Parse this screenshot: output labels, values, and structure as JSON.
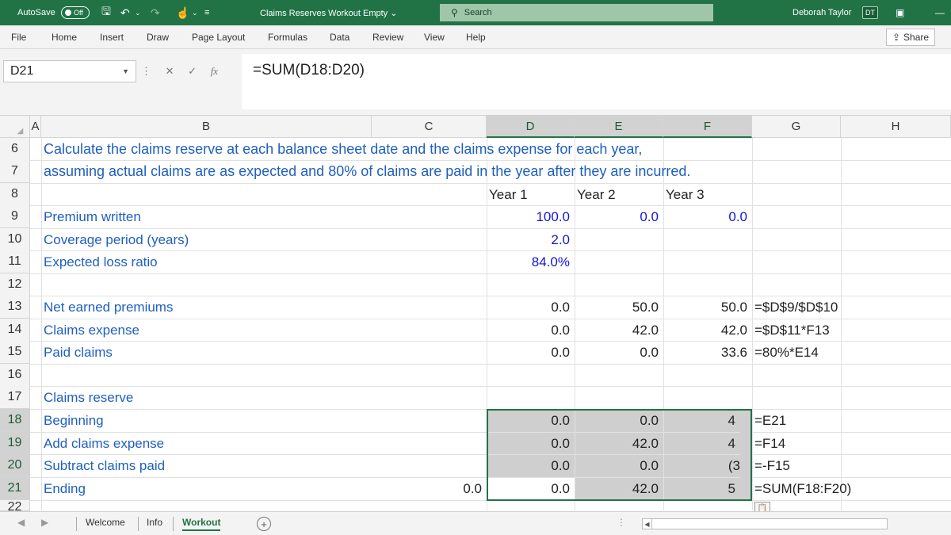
{
  "titlebar": {
    "autosave_label": "AutoSave",
    "autosave_state": "Off",
    "doc_title": "Claims Reserves Workout Empty ⌄",
    "search_placeholder": "Search",
    "user_name": "Deborah Taylor",
    "user_initials": "DT"
  },
  "menu": {
    "items": [
      "File",
      "Home",
      "Insert",
      "Draw",
      "Page Layout",
      "Formulas",
      "Data",
      "Review",
      "View",
      "Help"
    ],
    "share_label": "Share"
  },
  "formula_bar": {
    "name_box": "D21",
    "formula": "=SUM(D18:D20)"
  },
  "columns": [
    "A",
    "B",
    "C",
    "D",
    "E",
    "F",
    "G",
    "H"
  ],
  "rows": [
    "6",
    "7",
    "8",
    "9",
    "10",
    "11",
    "12",
    "13",
    "14",
    "15",
    "16",
    "17",
    "18",
    "19",
    "20",
    "21",
    "22"
  ],
  "sheet": {
    "r6_text": "Calculate the claims reserve at each balance sheet date and the claims expense for each year,",
    "r7_text": "assuming actual claims are as expected and 80% of claims are paid in the year after they are incurred.",
    "years": [
      "Year 1",
      "Year 2",
      "Year 3"
    ],
    "premium": {
      "label": "Premium written",
      "d": "100.0",
      "e": "0.0",
      "f": "0.0"
    },
    "coverage": {
      "label": "Coverage period (years)",
      "d": "2.0"
    },
    "loss_ratio": {
      "label": "Expected loss ratio",
      "d": "84.0%"
    },
    "net_earned": {
      "label": "Net earned premiums",
      "d": "0.0",
      "e": "50.0",
      "f": "50.0",
      "g": "=$D$9/$D$10"
    },
    "claims_expense": {
      "label": "Claims expense",
      "d": "0.0",
      "e": "42.0",
      "f": "42.0",
      "g": "=$D$11*F13"
    },
    "paid_claims": {
      "label": "Paid claims",
      "d": "0.0",
      "e": "0.0",
      "f": "33.6",
      "g": "=80%*E14"
    },
    "reserve_header": "Claims reserve",
    "beginning": {
      "label": "Beginning",
      "d": "0.0",
      "e": "0.0",
      "f": "4",
      "g": "=E21"
    },
    "add_expense": {
      "label": "Add claims expense",
      "d": "0.0",
      "e": "42.0",
      "f": "4",
      "g": "=F14"
    },
    "subtract_paid": {
      "label": "Subtract claims paid",
      "d": "0.0",
      "e": "0.0",
      "f": "(3",
      "g": "=-F15"
    },
    "ending": {
      "label": "Ending",
      "c": "0.0",
      "d": "0.0",
      "e": "42.0",
      "f": "5",
      "g": "=SUM(F18:F20)"
    }
  },
  "tabs": {
    "items": [
      "Welcome",
      "Info",
      "Workout"
    ],
    "active": "Workout"
  },
  "colors": {
    "accent": "#217346",
    "label_blue": "#1f5fbf",
    "input_blue": "#1414d6"
  }
}
